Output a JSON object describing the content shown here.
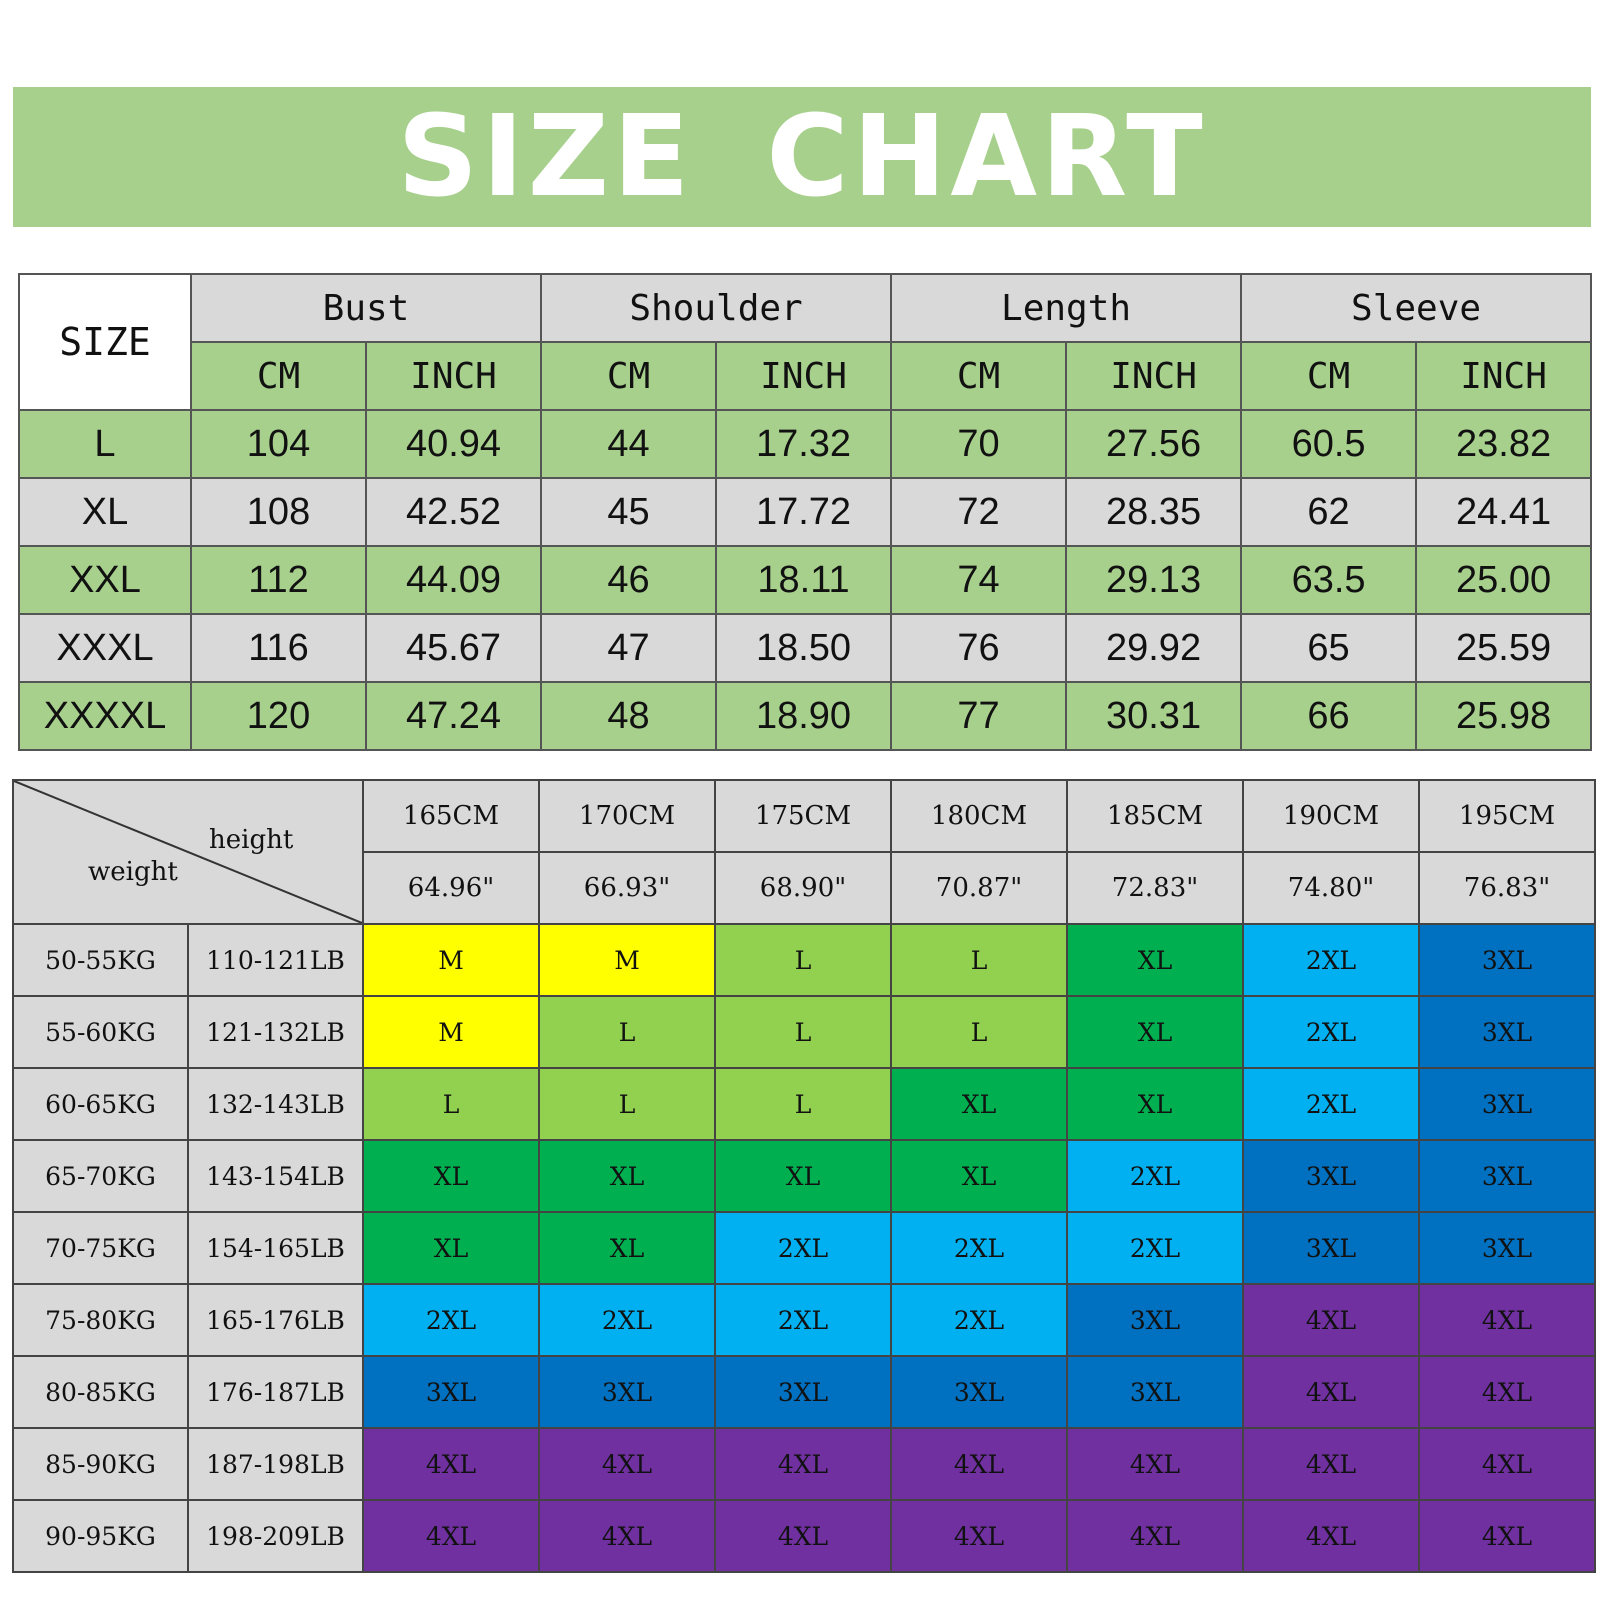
{
  "banner": {
    "title": "SIZE CHART"
  },
  "size_table": {
    "size_label": "SIZE",
    "groups": [
      "Bust",
      "Shoulder",
      "Length",
      "Sleeve"
    ],
    "units": [
      "CM",
      "INCH"
    ],
    "rows": [
      {
        "size": "L",
        "values": [
          "104",
          "40.94",
          "44",
          "17.32",
          "70",
          "27.56",
          "60.5",
          "23.82"
        ]
      },
      {
        "size": "XL",
        "values": [
          "108",
          "42.52",
          "45",
          "17.72",
          "72",
          "28.35",
          "62",
          "24.41"
        ]
      },
      {
        "size": "XXL",
        "values": [
          "112",
          "44.09",
          "46",
          "18.11",
          "74",
          "29.13",
          "63.5",
          "25.00"
        ]
      },
      {
        "size": "XXXL",
        "values": [
          "116",
          "45.67",
          "47",
          "18.50",
          "76",
          "29.92",
          "65",
          "25.59"
        ]
      },
      {
        "size": "XXXXL",
        "values": [
          "120",
          "47.24",
          "48",
          "18.90",
          "77",
          "30.31",
          "66",
          "25.98"
        ]
      }
    ]
  },
  "fit_table": {
    "corner_height": "height",
    "corner_weight": "weight",
    "heights_cm": [
      "165CM",
      "170CM",
      "175CM",
      "180CM",
      "185CM",
      "190CM",
      "195CM"
    ],
    "heights_in": [
      "64.96\"",
      "66.93\"",
      "68.90\"",
      "70.87\"",
      "72.83\"",
      "74.80\"",
      "76.83\""
    ],
    "rows": [
      {
        "kg": "50-55KG",
        "lb": "110-121LB",
        "sizes": [
          "M",
          "M",
          "L",
          "L",
          "XL",
          "2XL",
          "3XL"
        ]
      },
      {
        "kg": "55-60KG",
        "lb": "121-132LB",
        "sizes": [
          "M",
          "L",
          "L",
          "L",
          "XL",
          "2XL",
          "3XL"
        ]
      },
      {
        "kg": "60-65KG",
        "lb": "132-143LB",
        "sizes": [
          "L",
          "L",
          "L",
          "XL",
          "XL",
          "2XL",
          "3XL"
        ]
      },
      {
        "kg": "65-70KG",
        "lb": "143-154LB",
        "sizes": [
          "XL",
          "XL",
          "XL",
          "XL",
          "2XL",
          "3XL",
          "3XL"
        ]
      },
      {
        "kg": "70-75KG",
        "lb": "154-165LB",
        "sizes": [
          "XL",
          "XL",
          "2XL",
          "2XL",
          "2XL",
          "3XL",
          "3XL"
        ]
      },
      {
        "kg": "75-80KG",
        "lb": "165-176LB",
        "sizes": [
          "2XL",
          "2XL",
          "2XL",
          "2XL",
          "3XL",
          "4XL",
          "4XL"
        ]
      },
      {
        "kg": "80-85KG",
        "lb": "176-187LB",
        "sizes": [
          "3XL",
          "3XL",
          "3XL",
          "3XL",
          "3XL",
          "4XL",
          "4XL"
        ]
      },
      {
        "kg": "85-90KG",
        "lb": "187-198LB",
        "sizes": [
          "4XL",
          "4XL",
          "4XL",
          "4XL",
          "4XL",
          "4XL",
          "4XL"
        ]
      },
      {
        "kg": "90-95KG",
        "lb": "198-209LB",
        "sizes": [
          "4XL",
          "4XL",
          "4XL",
          "4XL",
          "4XL",
          "4XL",
          "4XL"
        ]
      }
    ],
    "size_colors": {
      "M": "#ffff00",
      "L": "#92d050",
      "XL": "#00b050",
      "2XL": "#00b0f0",
      "3XL": "#0070c0",
      "4XL": "#7030a0"
    }
  },
  "colors": {
    "banner_green": "#a8d08d",
    "row_gray": "#d9d9d9"
  }
}
